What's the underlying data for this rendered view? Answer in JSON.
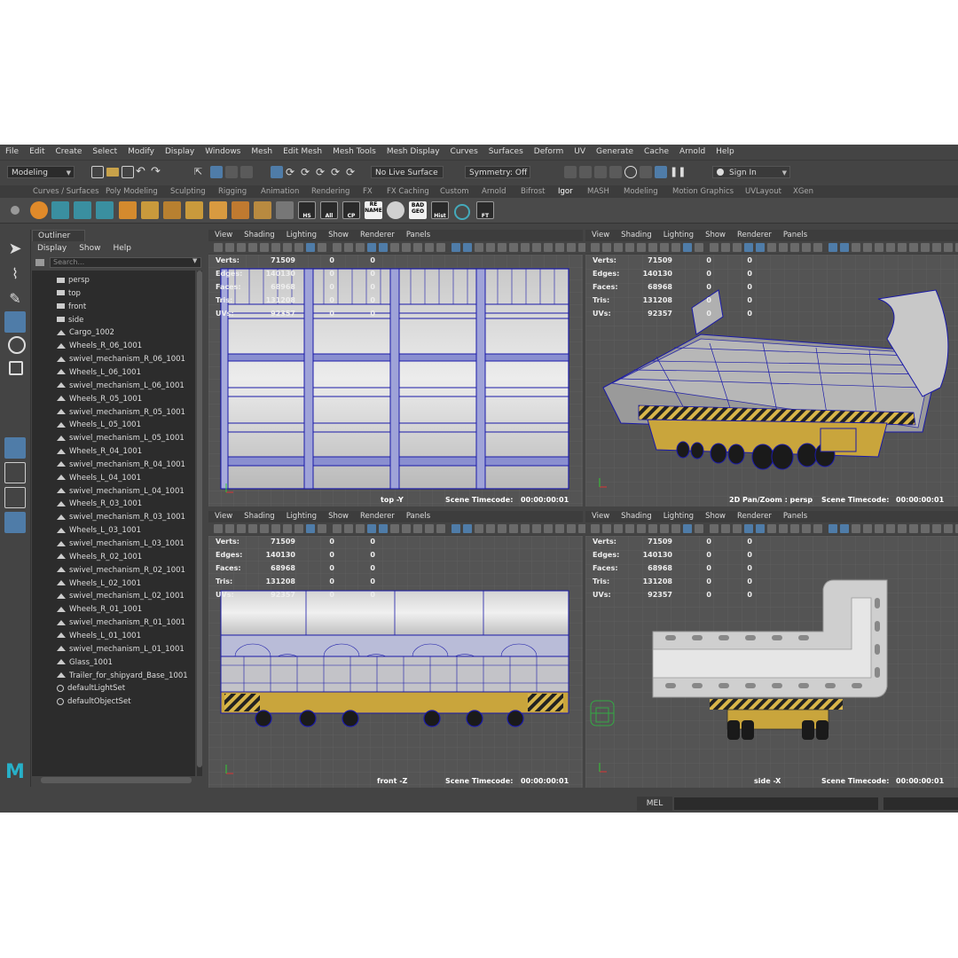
{
  "menubar": [
    "File",
    "Edit",
    "Create",
    "Select",
    "Modify",
    "Display",
    "Windows",
    "Mesh",
    "Edit Mesh",
    "Mesh Tools",
    "Mesh Display",
    "Curves",
    "Surfaces",
    "Deform",
    "UV",
    "Generate",
    "Cache",
    "Arnold",
    "Help"
  ],
  "statusline": {
    "mode": "Modeling",
    "live_surface": "No Live Surface",
    "symmetry": "Symmetry: Off",
    "sign_in": "Sign In"
  },
  "shelf_tabs": [
    "Curves / Surfaces",
    "Poly Modeling",
    "Sculpting",
    "Rigging",
    "Animation",
    "Rendering",
    "FX",
    "FX Caching",
    "Custom",
    "Arnold",
    "Bifrost",
    "Igor",
    "MASH",
    "Modeling",
    "Motion Graphics",
    "UVLayout",
    "XGen"
  ],
  "shelf_active": "Igor",
  "shelf_labels": {
    "hs": "HS",
    "all": "All",
    "cp": "CP",
    "rename": "RE NAME",
    "badgeo": "BAD GEO",
    "hist": "Hist",
    "ft": "FT"
  },
  "outliner": {
    "title": "Outliner",
    "menu": [
      "Display",
      "Show",
      "Help"
    ],
    "search_placeholder": "Search...",
    "items": [
      {
        "label": "persp",
        "type": "camera"
      },
      {
        "label": "top",
        "type": "camera"
      },
      {
        "label": "front",
        "type": "camera"
      },
      {
        "label": "side",
        "type": "camera"
      },
      {
        "label": "Cargo_1002",
        "type": "mesh"
      },
      {
        "label": "Wheels_R_06_1001",
        "type": "mesh"
      },
      {
        "label": "swivel_mechanism_R_06_1001",
        "type": "mesh"
      },
      {
        "label": "Wheels_L_06_1001",
        "type": "mesh"
      },
      {
        "label": "swivel_mechanism_L_06_1001",
        "type": "mesh"
      },
      {
        "label": "Wheels_R_05_1001",
        "type": "mesh"
      },
      {
        "label": "swivel_mechanism_R_05_1001",
        "type": "mesh"
      },
      {
        "label": "Wheels_L_05_1001",
        "type": "mesh"
      },
      {
        "label": "swivel_mechanism_L_05_1001",
        "type": "mesh"
      },
      {
        "label": "Wheels_R_04_1001",
        "type": "mesh"
      },
      {
        "label": "swivel_mechanism_R_04_1001",
        "type": "mesh"
      },
      {
        "label": "Wheels_L_04_1001",
        "type": "mesh"
      },
      {
        "label": "swivel_mechanism_L_04_1001",
        "type": "mesh"
      },
      {
        "label": "Wheels_R_03_1001",
        "type": "mesh"
      },
      {
        "label": "swivel_mechanism_R_03_1001",
        "type": "mesh"
      },
      {
        "label": "Wheels_L_03_1001",
        "type": "mesh"
      },
      {
        "label": "swivel_mechanism_L_03_1001",
        "type": "mesh"
      },
      {
        "label": "Wheels_R_02_1001",
        "type": "mesh"
      },
      {
        "label": "swivel_mechanism_R_02_1001",
        "type": "mesh"
      },
      {
        "label": "Wheels_L_02_1001",
        "type": "mesh"
      },
      {
        "label": "swivel_mechanism_L_02_1001",
        "type": "mesh"
      },
      {
        "label": "Wheels_R_01_1001",
        "type": "mesh"
      },
      {
        "label": "swivel_mechanism_R_01_1001",
        "type": "mesh"
      },
      {
        "label": "Wheels_L_01_1001",
        "type": "mesh"
      },
      {
        "label": "swivel_mechanism_L_01_1001",
        "type": "mesh"
      },
      {
        "label": "Glass_1001",
        "type": "mesh"
      },
      {
        "label": "Trailer_for_shipyard_Base_1001",
        "type": "mesh"
      },
      {
        "label": "defaultLightSet",
        "type": "set"
      },
      {
        "label": "defaultObjectSet",
        "type": "set"
      }
    ]
  },
  "viewport_menu": [
    "View",
    "Shading",
    "Lighting",
    "Show",
    "Renderer",
    "Panels"
  ],
  "hud": {
    "labels": [
      "Verts:",
      "Edges:",
      "Faces:",
      "Tris:",
      "UVs:"
    ],
    "values": [
      [
        "71509",
        "0",
        "0"
      ],
      [
        "140130",
        "0",
        "0"
      ],
      [
        "68968",
        "0",
        "0"
      ],
      [
        "131208",
        "0",
        "0"
      ],
      [
        "92357",
        "0",
        "0"
      ]
    ]
  },
  "timecode_label": "Scene Timecode:",
  "timecode_value": "00:00:00:01",
  "viewports": [
    {
      "camera": "top -Y"
    },
    {
      "camera": "2D Pan/Zoom : persp"
    },
    {
      "camera": "front -Z"
    },
    {
      "camera": "side -X"
    }
  ],
  "cmdline": {
    "mel": "MEL"
  },
  "colors": {
    "bg": "#444444",
    "selected": "#4f7ca8",
    "wire": "#1a1aa8",
    "yellow": "#c9a53c"
  }
}
